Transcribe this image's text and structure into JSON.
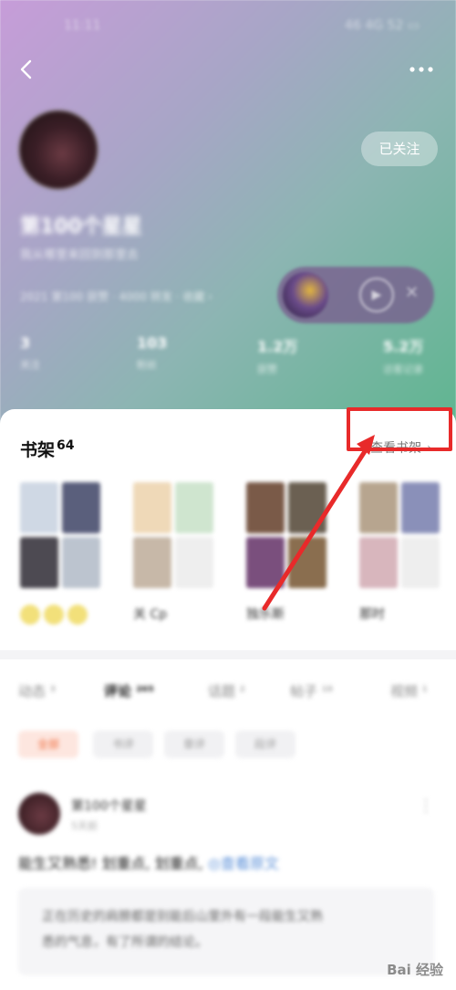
{
  "header": {
    "status_time": "11:11",
    "status_right": "46 4G 52 ▭",
    "follow_label": "已关注",
    "username": "第100个星星",
    "bio": "我从哪里来回到那里去",
    "stats_line": "2021 第100 获赞 · 4000 转发 · 收藏 ›",
    "metrics": [
      {
        "num": "3",
        "label": "关注"
      },
      {
        "num": "103",
        "label": "粉丝"
      },
      {
        "num": "1.2万",
        "label": "获赞"
      },
      {
        "num": "5.2万",
        "label": "访客记录"
      }
    ]
  },
  "shelf": {
    "title": "书架",
    "count": "64",
    "view_label": "查看书架",
    "books": [
      {
        "name": "",
        "colors": [
          "#cfd8e4",
          "#5a5f7c",
          "#4d4a52",
          "#bcc4cf"
        ]
      },
      {
        "name": "关 Cp",
        "colors": [
          "#efd9b8",
          "#cfe5cf",
          "#c7b8a8",
          "#eeeeee"
        ]
      },
      {
        "name": "独乐斯",
        "colors": [
          "#7a5a48",
          "#6b6052",
          "#7a4f7d",
          "#8a6e4f"
        ]
      },
      {
        "name": "那时",
        "colors": [
          "#b7a58f",
          "#8a90b9",
          "#d8b6bd",
          "#eeeeee"
        ]
      }
    ]
  },
  "tabs": [
    {
      "label": "动态 ³",
      "active": false
    },
    {
      "label": "评论 ²⁶⁵",
      "active": true
    },
    {
      "label": "话题 ²",
      "active": false
    },
    {
      "label": "帖子 ¹⁸",
      "active": false
    },
    {
      "label": "视频 ¹",
      "active": false
    }
  ],
  "chips": [
    {
      "label": "全部",
      "active": true
    },
    {
      "label": "书评",
      "active": false
    },
    {
      "label": "章评",
      "active": false
    },
    {
      "label": "段评",
      "active": false
    }
  ],
  "post": {
    "user": "第100个星星",
    "time": "5天前",
    "text": "能生又熟悉! 划重点, 划重点,",
    "link": "◎查看原文",
    "quote_line1": "正在历史的肩膀都是别能后山里外有一段能生又熟",
    "quote_line2": "悉的气息，有了所谓的结论。"
  },
  "watermark": "Bai 经验"
}
